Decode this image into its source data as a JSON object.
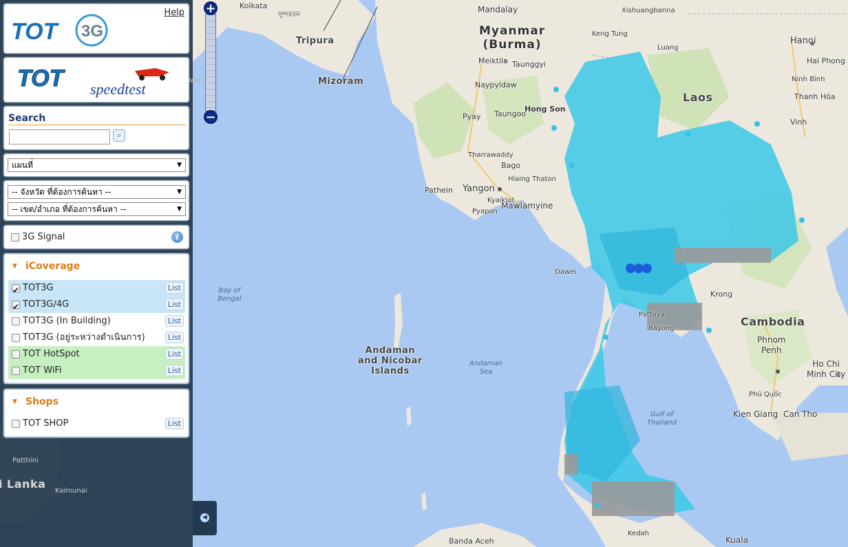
{
  "header": {
    "help_label": "Help",
    "logo_text": "TOT",
    "logo_suffix": "3G"
  },
  "speedtest": {
    "brand": "TOT",
    "word": "speedtest"
  },
  "search": {
    "title": "Search",
    "value": "",
    "placeholder": "",
    "button_icon": "search-icon"
  },
  "map_type": {
    "selected": "แผนที่"
  },
  "region": {
    "province": "-- จังหวัด ที่ต้องการค้นหา --",
    "district": "-- เขต/อำเภอ ที่ต้องการค้นหา --"
  },
  "signal": {
    "label": "3G Signal",
    "checked": false,
    "info_icon": "info-icon"
  },
  "coverage": {
    "title": "iCoverage",
    "list_label": "List",
    "items": [
      {
        "label": "TOT3G",
        "checked": true
      },
      {
        "label": "TOT3G/4G",
        "checked": true
      },
      {
        "label": "TOT3G (In Building)",
        "checked": false
      },
      {
        "label": "TOT3G (อยู่ระหว่างดำเนินการ)",
        "checked": false
      },
      {
        "label": "TOT HotSpot",
        "checked": false
      },
      {
        "label": "TOT WiFi",
        "checked": false
      }
    ]
  },
  "shops": {
    "title": "Shops",
    "list_label": "List",
    "items": [
      {
        "label": "TOT SHOP",
        "checked": false
      }
    ]
  },
  "map": {
    "labels": {
      "kolkata": "Kolkata",
      "sundarban": "সুন্দরবন",
      "tripura": "Tripura",
      "mizoram": "Mizoram",
      "mandalay": "Mandalay",
      "myanmar_1": "Myanmar",
      "myanmar_2": "(Burma)",
      "meiktila": "Meiktila",
      "taunggyi": "Taunggyi",
      "naypyidaw": "Naypyidaw",
      "taungoo": "Taungoo",
      "hongson": "Hong Son",
      "pyay": "Pyay",
      "tharrawaddy": "Tharrawaddy",
      "bago": "Bago",
      "pathein": "Pathein",
      "yangon": "Yangon",
      "hlainghthaton": "Hlaing Thaton",
      "mawlamyine": "Mawlamyine",
      "kyaiklat": "Kyaiklat",
      "pyapon": "Pyapon",
      "dawei": "Dawei",
      "bay_1": "Bay of",
      "bay_2": "Bengal",
      "andaman_1": "Andaman",
      "andaman_2": "and Nicobar",
      "andaman_3": "Islands",
      "andamansea_1": "Andaman",
      "andamansea_2": "Sea",
      "kengtung": "Keng Tung",
      "xishuangbanna": "Xishuangbanna",
      "luang": "Luang",
      "laos": "Laos",
      "hanoi": "Hanoi",
      "haiphong": "Hai Phong",
      "ninhbinh": "Ninh Bình",
      "thanhhoa": "Thanh Hóa",
      "vinh": "Vinh",
      "cambodia": "Cambodia",
      "krong": "Krong",
      "phnompenh_1": "Phnom",
      "phnompenh_2": "Penh",
      "hochiminh_1": "Ho Chi",
      "hochiminh_2": "Minh City",
      "phuquoc": "Phú Quốc",
      "kiengiang": "Kien Giang",
      "cantho": "Can Tho",
      "gulf_1": "Gulf of",
      "gulf_2": "Thailand",
      "pattaya": "Pattaya",
      "rayong": "Rayong",
      "bandaaceh": "Banda Aceh",
      "kedah": "Kedah",
      "kuala": "Kuala",
      "srilanka": "i Lanka",
      "patthini": "Patthini",
      "kalmunai": "Kalmunai",
      "awar": "war"
    }
  }
}
